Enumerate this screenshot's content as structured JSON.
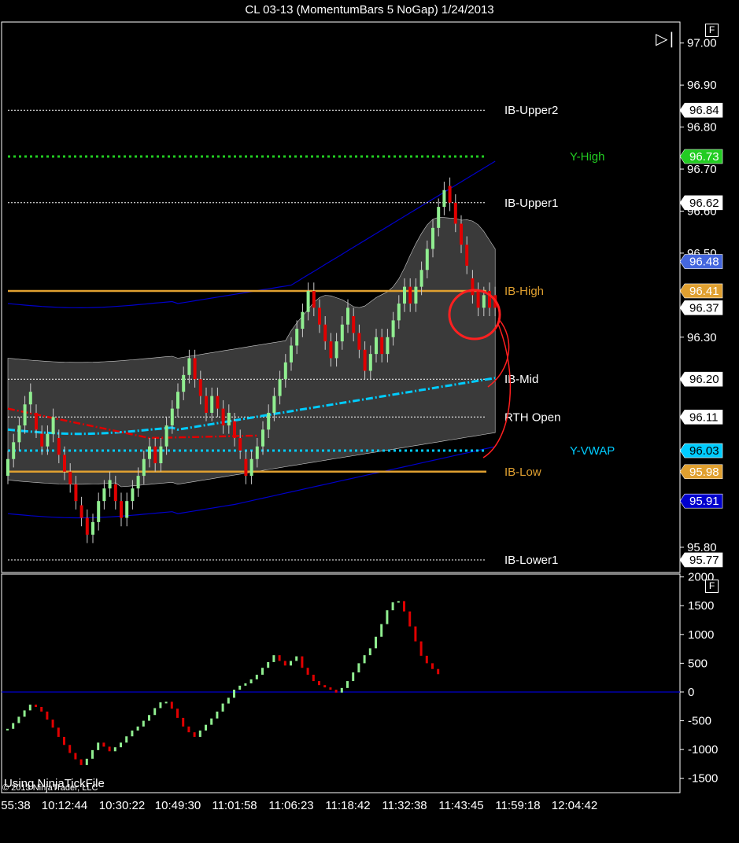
{
  "window": {
    "title": "CL 03-13 (MomentumBars 5 NoGap)  1/24/2013"
  },
  "buttons": {
    "f_label": "F",
    "play_icon": "play-end-icon"
  },
  "footer": {
    "watermark": "Using NinjaTickFile",
    "copyright": "© 2013 NinjaTrader, LLC"
  },
  "colors": {
    "up": "#90ee90",
    "down": "#e00000",
    "ib": "#e0a030",
    "vwap": "#00ccff",
    "yhigh": "#22cc22",
    "vwap_band": "#0000cc",
    "ma_red": "#e00000",
    "zero": "#0000cc"
  },
  "chart_data": [
    {
      "type": "candlestick",
      "title": "CL 03-13 (MomentumBars 5 NoGap)  1/24/2013",
      "ylim": [
        95.74,
        97.05
      ],
      "y_ticks": [
        "97.00",
        "96.90",
        "96.80",
        "96.70",
        "96.60",
        "96.50",
        "96.30",
        "95.80"
      ],
      "x_ticks": [
        "55:38",
        "10:12:44",
        "10:30:22",
        "10:49:30",
        "11:01:58",
        "11:06:23",
        "11:18:42",
        "11:32:38",
        "11:43:45",
        "11:59:18",
        "12:04:42"
      ],
      "levels": [
        {
          "label": "IB-Upper2",
          "value": 96.84,
          "tag": "96.84",
          "color": "#ffffff",
          "style": "dotted-thin"
        },
        {
          "label": "Y-High",
          "value": 96.73,
          "tag": "96.73",
          "color": "#22cc22",
          "style": "dotted-thick"
        },
        {
          "label": "IB-Upper1",
          "value": 96.62,
          "tag": "96.62",
          "color": "#ffffff",
          "style": "dotted-thin"
        },
        {
          "label": "IB-High",
          "value": 96.41,
          "tag": "96.41",
          "color": "#e0a030",
          "style": "solid"
        },
        {
          "label": "IB-Mid",
          "value": 96.2,
          "tag": "96.20",
          "color": "#ffffff",
          "style": "dotted-thin"
        },
        {
          "label": "RTH Open",
          "value": 96.11,
          "tag": "96.11",
          "color": "#ffffff",
          "style": "dotted-thin"
        },
        {
          "label": "Y-VWAP",
          "value": 96.03,
          "tag": "96.03",
          "color": "#00ccff",
          "style": "dotted-thick"
        },
        {
          "label": "IB-Low",
          "value": 95.98,
          "tag": "95.98",
          "color": "#e0a030",
          "style": "solid"
        },
        {
          "label": "IB-Lower1",
          "value": 95.77,
          "tag": "95.77",
          "color": "#ffffff",
          "style": "dotted-thin"
        }
      ],
      "extra_tags": [
        {
          "value": 96.48,
          "text": "96.48",
          "color": "#4466dd"
        },
        {
          "value": 96.37,
          "text": "96.37",
          "color": "#ffffff"
        },
        {
          "value": 95.91,
          "text": "95.91",
          "color": "#0000cc"
        }
      ],
      "bars": [
        {
          "o": 95.97,
          "c": 96.01
        },
        {
          "o": 96.01,
          "c": 96.05
        },
        {
          "o": 96.05,
          "c": 96.09
        },
        {
          "o": 96.09,
          "c": 96.14
        },
        {
          "o": 96.14,
          "c": 96.17
        },
        {
          "o": 96.12,
          "c": 96.08
        },
        {
          "o": 96.07,
          "c": 96.04
        },
        {
          "o": 96.04,
          "c": 96.07
        },
        {
          "o": 96.07,
          "c": 96.11
        },
        {
          "o": 96.06,
          "c": 96.02
        },
        {
          "o": 96.02,
          "c": 95.98
        },
        {
          "o": 95.98,
          "c": 95.95
        },
        {
          "o": 95.95,
          "c": 95.91
        },
        {
          "o": 95.9,
          "c": 95.87
        },
        {
          "o": 95.87,
          "c": 95.83
        },
        {
          "o": 95.83,
          "c": 95.86
        },
        {
          "o": 95.86,
          "c": 95.91
        },
        {
          "o": 95.91,
          "c": 95.94
        },
        {
          "o": 95.94,
          "c": 95.96
        },
        {
          "o": 95.95,
          "c": 95.91
        },
        {
          "o": 95.91,
          "c": 95.87
        },
        {
          "o": 95.87,
          "c": 95.91
        },
        {
          "o": 95.91,
          "c": 95.94
        },
        {
          "o": 95.94,
          "c": 95.97
        },
        {
          "o": 95.97,
          "c": 96.01
        },
        {
          "o": 96.01,
          "c": 96.04
        },
        {
          "o": 96.04,
          "c": 96.0
        },
        {
          "o": 96.0,
          "c": 96.04
        },
        {
          "o": 96.04,
          "c": 96.09
        },
        {
          "o": 96.09,
          "c": 96.13
        },
        {
          "o": 96.13,
          "c": 96.17
        },
        {
          "o": 96.17,
          "c": 96.21
        },
        {
          "o": 96.21,
          "c": 96.25
        },
        {
          "o": 96.25,
          "c": 96.2
        },
        {
          "o": 96.2,
          "c": 96.16
        },
        {
          "o": 96.16,
          "c": 96.12
        },
        {
          "o": 96.12,
          "c": 96.16
        },
        {
          "o": 96.16,
          "c": 96.13
        },
        {
          "o": 96.13,
          "c": 96.09
        },
        {
          "o": 96.09,
          "c": 96.12
        },
        {
          "o": 96.1,
          "c": 96.06
        },
        {
          "o": 96.06,
          "c": 96.03
        },
        {
          "o": 96.01,
          "c": 95.97
        },
        {
          "o": 95.97,
          "c": 96.01
        },
        {
          "o": 96.01,
          "c": 96.04
        },
        {
          "o": 96.04,
          "c": 96.08
        },
        {
          "o": 96.08,
          "c": 96.12
        },
        {
          "o": 96.12,
          "c": 96.16
        },
        {
          "o": 96.16,
          "c": 96.2
        },
        {
          "o": 96.2,
          "c": 96.24
        },
        {
          "o": 96.24,
          "c": 96.28
        },
        {
          "o": 96.28,
          "c": 96.32
        },
        {
          "o": 96.32,
          "c": 96.36
        },
        {
          "o": 96.36,
          "c": 96.41
        },
        {
          "o": 96.41,
          "c": 96.37
        },
        {
          "o": 96.37,
          "c": 96.33
        },
        {
          "o": 96.33,
          "c": 96.29
        },
        {
          "o": 96.29,
          "c": 96.25
        },
        {
          "o": 96.25,
          "c": 96.29
        },
        {
          "o": 96.29,
          "c": 96.33
        },
        {
          "o": 96.33,
          "c": 96.37
        },
        {
          "o": 96.35,
          "c": 96.31
        },
        {
          "o": 96.31,
          "c": 96.27
        },
        {
          "o": 96.27,
          "c": 96.22
        },
        {
          "o": 96.22,
          "c": 96.26
        },
        {
          "o": 96.26,
          "c": 96.3
        },
        {
          "o": 96.3,
          "c": 96.26
        },
        {
          "o": 96.26,
          "c": 96.3
        },
        {
          "o": 96.3,
          "c": 96.34
        },
        {
          "o": 96.34,
          "c": 96.38
        },
        {
          "o": 96.38,
          "c": 96.42
        },
        {
          "o": 96.42,
          "c": 96.38
        },
        {
          "o": 96.38,
          "c": 96.42
        },
        {
          "o": 96.42,
          "c": 96.46
        },
        {
          "o": 96.46,
          "c": 96.51
        },
        {
          "o": 96.51,
          "c": 96.56
        },
        {
          "o": 96.56,
          "c": 96.61
        },
        {
          "o": 96.61,
          "c": 96.65
        },
        {
          "o": 96.66,
          "c": 96.62
        },
        {
          "o": 96.62,
          "c": 96.57
        },
        {
          "o": 96.57,
          "c": 96.52
        },
        {
          "o": 96.52,
          "c": 96.47
        },
        {
          "o": 96.44,
          "c": 96.4
        },
        {
          "o": 96.41,
          "c": 96.37
        },
        {
          "o": 96.37,
          "c": 96.4
        },
        {
          "o": 96.41,
          "c": 96.37
        },
        {
          "o": 96.4,
          "c": 96.37
        }
      ]
    },
    {
      "type": "bar",
      "title": "",
      "ylim": [
        -1750,
        2050
      ],
      "y_ticks": [
        "2000",
        "1500",
        "1000",
        "500",
        "0",
        "-500",
        "-1000",
        "-1500"
      ],
      "zero_line": 0,
      "values": [
        -640,
        -540,
        -430,
        -320,
        -220,
        -260,
        -340,
        -480,
        -620,
        -780,
        -920,
        -1060,
        -1170,
        -1270,
        -1160,
        -1010,
        -880,
        -950,
        -1030,
        -960,
        -880,
        -770,
        -670,
        -600,
        -500,
        -400,
        -280,
        -180,
        -170,
        -290,
        -450,
        -600,
        -700,
        -780,
        -670,
        -570,
        -460,
        -340,
        -200,
        -100,
        40,
        110,
        150,
        220,
        300,
        420,
        520,
        640,
        540,
        460,
        540,
        620,
        420,
        300,
        190,
        120,
        80,
        40,
        -10,
        70,
        190,
        340,
        500,
        640,
        760,
        960,
        1180,
        1420,
        1560,
        1580,
        1400,
        1140,
        880,
        630,
        500,
        400,
        310
      ]
    }
  ]
}
